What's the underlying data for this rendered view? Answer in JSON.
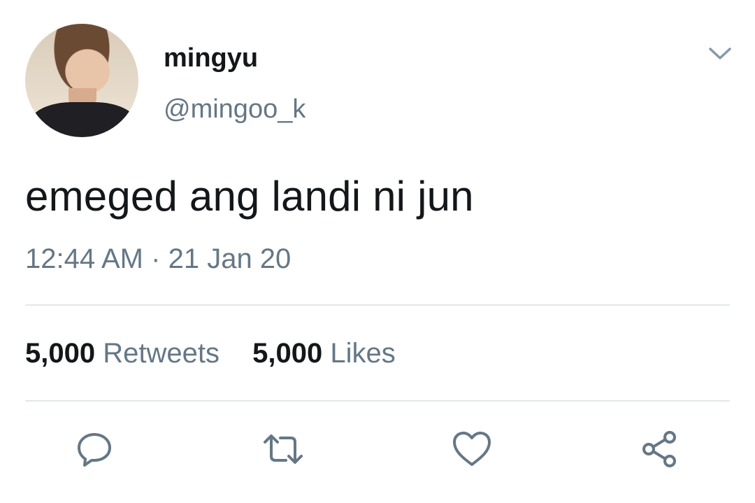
{
  "tweet": {
    "display_name": "mingyu",
    "handle": "@mingoo_k",
    "text": "emeged ang landi ni jun",
    "time": "12:44 AM",
    "separator": "·",
    "date": "21 Jan 20"
  },
  "stats": {
    "retweets_count": "5,000",
    "retweets_label": "Retweets",
    "likes_count": "5,000",
    "likes_label": "Likes"
  },
  "icons": {
    "more": "chevron-down-icon",
    "reply": "comment-icon",
    "retweet": "retweet-icon",
    "like": "heart-icon",
    "share": "share-icon"
  },
  "colors": {
    "text": "#14171a",
    "secondary": "#657786",
    "divider": "#e1e8ed",
    "icon": "#657786"
  }
}
